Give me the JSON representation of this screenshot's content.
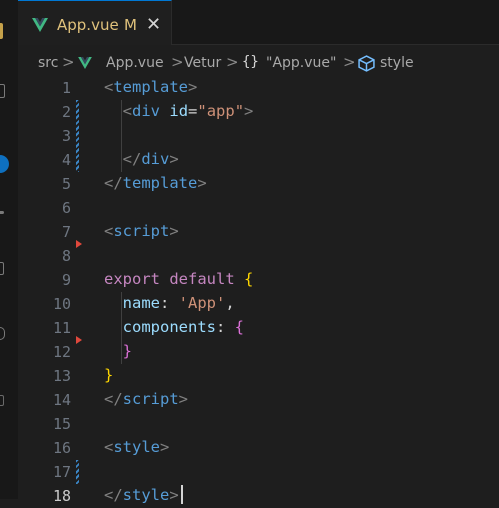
{
  "tab": {
    "label": "App.vue",
    "modified": "M",
    "close": "✕",
    "icon": "vue-icon"
  },
  "breadcrumb": {
    "src": "src",
    "file": "App.vue",
    "vetur": "Vetur",
    "braces": "{}",
    "component": "\"App.vue\"",
    "style": "style",
    "separator": ">"
  },
  "editor": {
    "lines": [
      {
        "num": "1",
        "tokens": [
          [
            "t-punc",
            "<"
          ],
          [
            "t-tag",
            "template"
          ],
          [
            "t-punc",
            ">"
          ]
        ]
      },
      {
        "num": "2",
        "tokens": [
          [
            "t-plain",
            "  "
          ],
          [
            "t-punc",
            "<"
          ],
          [
            "t-tag",
            "div"
          ],
          [
            "t-plain",
            " "
          ],
          [
            "t-attr",
            "id"
          ],
          [
            "t-eq",
            "="
          ],
          [
            "t-str",
            "\"app\""
          ],
          [
            "t-punc",
            ">"
          ]
        ]
      },
      {
        "num": "3",
        "tokens": []
      },
      {
        "num": "4",
        "tokens": [
          [
            "t-plain",
            "  "
          ],
          [
            "t-punc",
            "</"
          ],
          [
            "t-tag",
            "div"
          ],
          [
            "t-punc",
            ">"
          ]
        ]
      },
      {
        "num": "5",
        "tokens": [
          [
            "t-punc",
            "</"
          ],
          [
            "t-tag",
            "template"
          ],
          [
            "t-punc",
            ">"
          ]
        ]
      },
      {
        "num": "6",
        "tokens": []
      },
      {
        "num": "7",
        "tokens": [
          [
            "t-punc",
            "<"
          ],
          [
            "t-tag",
            "script"
          ],
          [
            "t-punc",
            ">"
          ]
        ]
      },
      {
        "num": "8",
        "tokens": []
      },
      {
        "num": "9",
        "tokens": [
          [
            "t-kw",
            "export"
          ],
          [
            "t-plain",
            " "
          ],
          [
            "t-kw",
            "default"
          ],
          [
            "t-plain",
            " "
          ],
          [
            "t-brace",
            "{"
          ]
        ]
      },
      {
        "num": "10",
        "tokens": [
          [
            "t-plain",
            "  "
          ],
          [
            "t-prop",
            "name"
          ],
          [
            "t-plain",
            ": "
          ],
          [
            "t-str",
            "'App'"
          ],
          [
            "t-plain",
            ","
          ]
        ]
      },
      {
        "num": "11",
        "tokens": [
          [
            "t-plain",
            "  "
          ],
          [
            "t-prop",
            "components"
          ],
          [
            "t-plain",
            ": "
          ],
          [
            "t-brace2",
            "{"
          ]
        ]
      },
      {
        "num": "12",
        "tokens": [
          [
            "t-plain",
            "  "
          ],
          [
            "t-brace2",
            "}"
          ]
        ]
      },
      {
        "num": "13",
        "tokens": [
          [
            "t-brace",
            "}"
          ]
        ]
      },
      {
        "num": "14",
        "tokens": [
          [
            "t-punc",
            "</"
          ],
          [
            "t-tag",
            "script"
          ],
          [
            "t-punc",
            ">"
          ]
        ]
      },
      {
        "num": "15",
        "tokens": []
      },
      {
        "num": "16",
        "tokens": [
          [
            "t-punc",
            "<"
          ],
          [
            "t-tag",
            "style"
          ],
          [
            "t-punc",
            ">"
          ]
        ]
      },
      {
        "num": "17",
        "tokens": []
      },
      {
        "num": "18",
        "tokens": [
          [
            "t-punc",
            "</"
          ],
          [
            "t-tag",
            "style"
          ],
          [
            "t-punc",
            ">"
          ]
        ]
      }
    ],
    "active_line": "18",
    "modified_lines": [
      "2",
      "3",
      "4",
      "17"
    ],
    "deleted_markers_after": [
      "7",
      "12"
    ]
  },
  "colors": {
    "background": "#1e1e1e",
    "accent": "#0078d4",
    "tab_modified": "#e0c27c",
    "vue_green": "#41b883",
    "vue_dark": "#35495e",
    "gutter_modified": "#3b86c6",
    "gutter_deleted": "#e0483c"
  }
}
